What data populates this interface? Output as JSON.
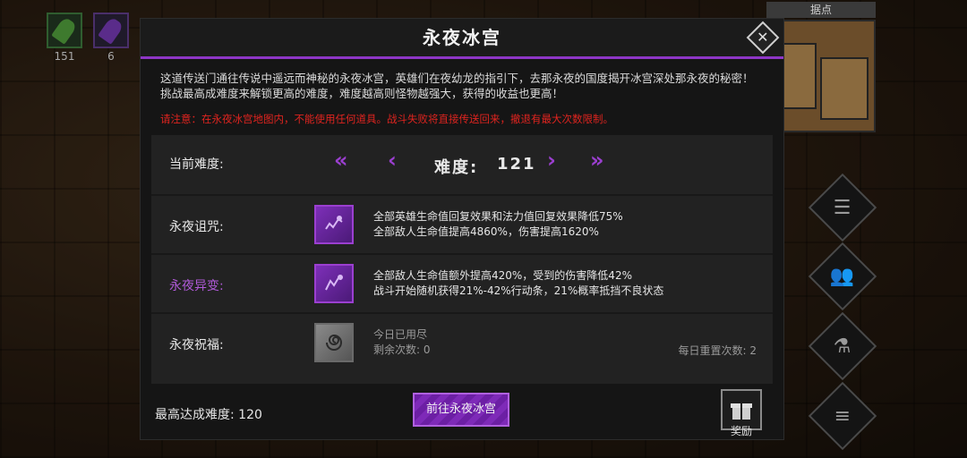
{
  "hud": {
    "items": [
      {
        "icon": "green-crystal-icon",
        "count": "151"
      },
      {
        "icon": "purple-crystal-icon",
        "count": "6"
      }
    ],
    "minimap_title": "据点",
    "side_buttons": [
      "scroll-icon",
      "party-icon",
      "potion-icon",
      "menu-list-icon"
    ]
  },
  "dialog": {
    "title": "永夜冰宫",
    "description_line1": "这道传送门通往传说中遥远而神秘的永夜冰宫，英雄们在夜幼龙的指引下，去那永夜的国度揭开冰宫深处那永夜的秘密！",
    "description_line2": "挑战最高成难度来解锁更高的难度，难度越高则怪物越强大，获得的收益也更高！",
    "warning": "请注意：在永夜冰宫地图内，不能使用任何道具。战斗失败将直接传送回来，撤退有最大次数限制。",
    "difficulty": {
      "label": "当前难度:",
      "text": "难度:",
      "value": "121"
    },
    "curse": {
      "label": "永夜诅咒:",
      "line1": "全部英雄生命值回复效果和法力值回复效果降低75%",
      "line2": "全部敌人生命值提高4860%，伤害提高1620%"
    },
    "mutation": {
      "label": "永夜异变:",
      "line1": "全部敌人生命值额外提高420%，受到的伤害降低42%",
      "line2": "战斗开始随机获得21%-42%行动条，21%概率抵挡不良状态"
    },
    "blessing": {
      "label": "永夜祝福:",
      "line1": "今日已用尽",
      "line2": "剩余次数: 0",
      "reset": "每日重置次数: 2"
    },
    "max_difficulty": "最高达成难度: 120",
    "go_button": "前往永夜冰宫",
    "reward_label": "奖励"
  },
  "colors": {
    "accent_purple": "#9b3fd0",
    "warning_red": "#e0241f",
    "panel": "#222222"
  }
}
